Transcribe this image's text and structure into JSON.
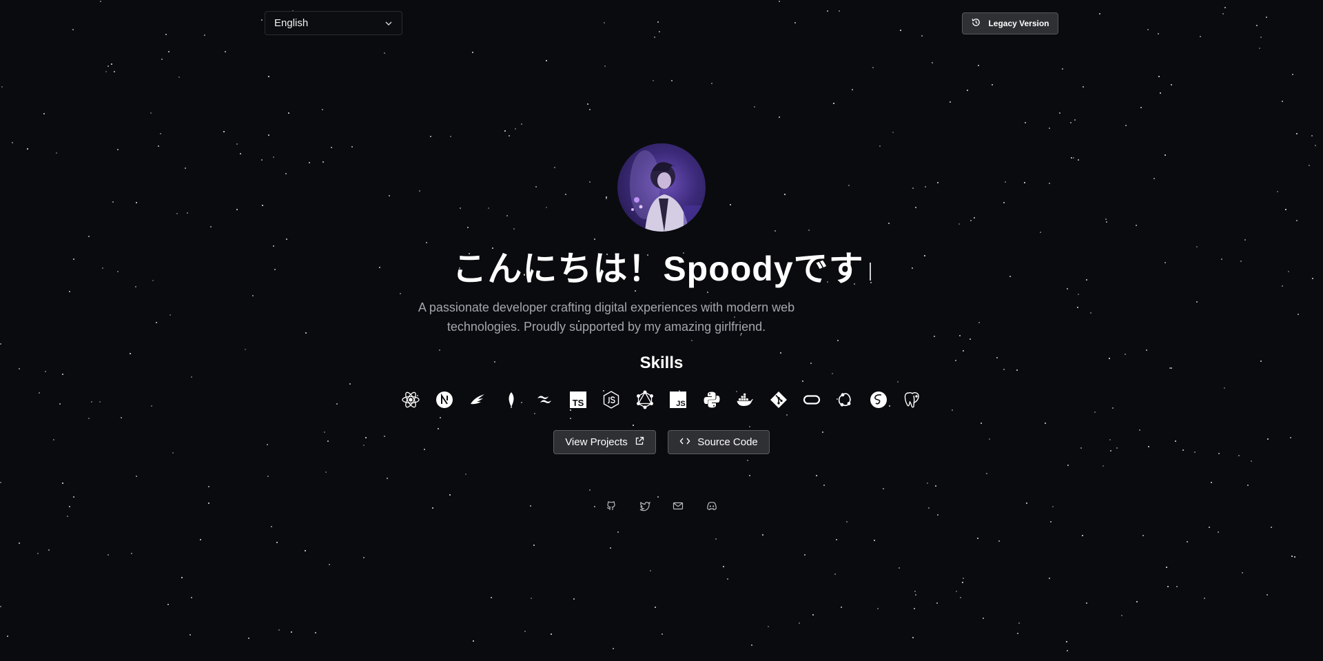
{
  "language_select": {
    "value": "English",
    "icon": "chevron-down-icon"
  },
  "legacy_button": {
    "label": "Legacy Version",
    "icon": "history-icon"
  },
  "hero": {
    "avatar": "anime-character-avatar",
    "title": "こんにちは！Spoodyです",
    "subtitle": "A passionate developer crafting digital experiences with modern web technologies. Proudly supported by my amazing girlfriend."
  },
  "skills": {
    "heading": "Skills",
    "items": [
      {
        "name": "react-icon"
      },
      {
        "name": "nextjs-icon"
      },
      {
        "name": "express-icon"
      },
      {
        "name": "mongodb-icon"
      },
      {
        "name": "tailwind-icon"
      },
      {
        "name": "typescript-icon",
        "text": "TS"
      },
      {
        "name": "nodejs-icon"
      },
      {
        "name": "graphql-icon"
      },
      {
        "name": "javascript-icon",
        "text": "JS"
      },
      {
        "name": "python-icon"
      },
      {
        "name": "docker-icon"
      },
      {
        "name": "git-icon"
      },
      {
        "name": "oracle-icon"
      },
      {
        "name": "redux-icon"
      },
      {
        "name": "sass-icon"
      },
      {
        "name": "postgresql-icon"
      }
    ]
  },
  "actions": {
    "view_projects": {
      "label": "View Projects",
      "icon": "external-link-icon"
    },
    "source_code": {
      "label": "Source Code",
      "icon": "code-icon"
    }
  },
  "socials": [
    {
      "name": "github-icon"
    },
    {
      "name": "twitter-icon"
    },
    {
      "name": "mail-icon"
    },
    {
      "name": "discord-icon"
    }
  ],
  "colors": {
    "background": "#0a0b0e",
    "button_bg": "#2f3034",
    "subtitle_text": "#a3a6ad",
    "avatar_accent": "#6b4fb8"
  }
}
